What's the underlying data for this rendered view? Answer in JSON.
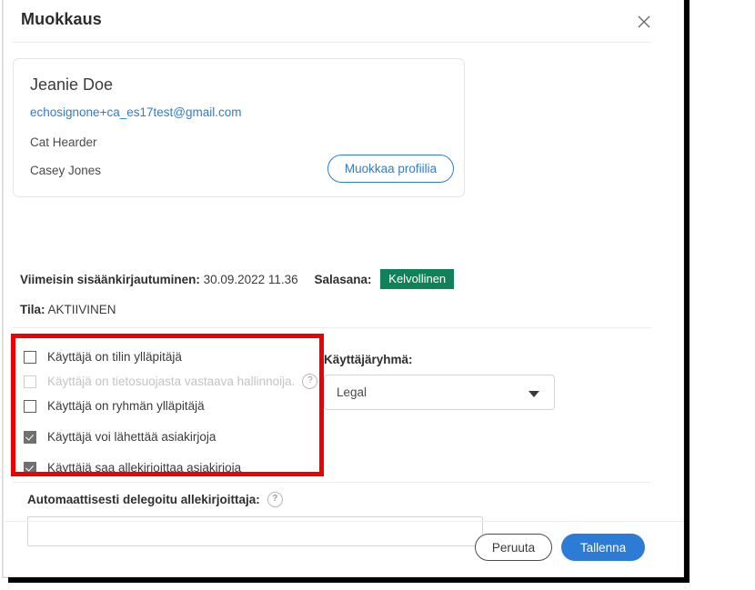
{
  "dialog": {
    "title": "Muokkaus",
    "close_icon": "close-icon"
  },
  "profile": {
    "name": "Jeanie Doe",
    "email": "echosignone+ca_es17test@gmail.com",
    "job_title": "Cat Hearder",
    "company": "Casey Jones",
    "edit_button": "Muokkaa profiilia"
  },
  "meta": {
    "last_login_label": "Viimeisin sisäänkirjautuminen:",
    "last_login_value": "30.09.2022 11.36",
    "password_label": "Salasana:",
    "password_badge": "Kelvollinen",
    "status_label": "Tila:",
    "status_value": "AKTIIVINEN"
  },
  "permissions": [
    {
      "label": "Käyttäjä on tilin ylläpitäjä",
      "checked": false,
      "disabled": false,
      "help": false
    },
    {
      "label": "Käyttäjä on tietosuojasta vastaava hallinnoija.",
      "checked": false,
      "disabled": true,
      "help": true
    },
    {
      "label": "Käyttäjä on ryhmän ylläpitäjä",
      "checked": false,
      "disabled": false,
      "help": false
    },
    {
      "label": "Käyttäjä voi lähettää asiakirjoja",
      "checked": true,
      "disabled": false,
      "help": false
    },
    {
      "label": "Käyttäjä saa allekirjoittaa asiakirjoja",
      "checked": true,
      "disabled": false,
      "help": false
    }
  ],
  "user_group": {
    "label": "Käyttäjäryhmä:",
    "selected": "Legal",
    "caret_icon": "chevron-down-icon"
  },
  "delegate": {
    "label": "Automaattisesti delegoitu allekirjoittaja:",
    "help_icon": "help-circle-icon",
    "value": "",
    "placeholder": ""
  },
  "footer": {
    "cancel": "Peruuta",
    "save": "Tallenna"
  },
  "annotation": {
    "highlight_color": "#EF0000"
  }
}
